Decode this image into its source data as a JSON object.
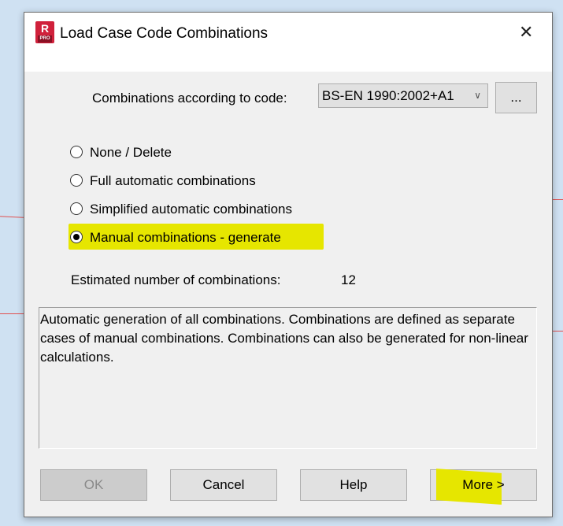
{
  "window": {
    "title": "Load Case Code Combinations",
    "logo_letter": "R",
    "logo_badge": "PRO"
  },
  "code": {
    "label": "Combinations according to code:",
    "selected": "BS-EN 1990:2002+A1",
    "browse_label": "..."
  },
  "options": [
    {
      "label": "None / Delete",
      "selected": false
    },
    {
      "label": "Full automatic combinations",
      "selected": false
    },
    {
      "label": "Simplified automatic combinations",
      "selected": false
    },
    {
      "label": "Manual combinations - generate",
      "selected": true
    }
  ],
  "estimate": {
    "label": "Estimated number of combinations:",
    "value": "12"
  },
  "description": "Automatic generation of all combinations. Combinations are defined as separate cases of manual combinations. Combinations can also be generated for non-linear calculations.",
  "buttons": {
    "ok": "OK",
    "cancel": "Cancel",
    "help": "Help",
    "more": "More >"
  },
  "colors": {
    "highlight": "#e6e600"
  }
}
